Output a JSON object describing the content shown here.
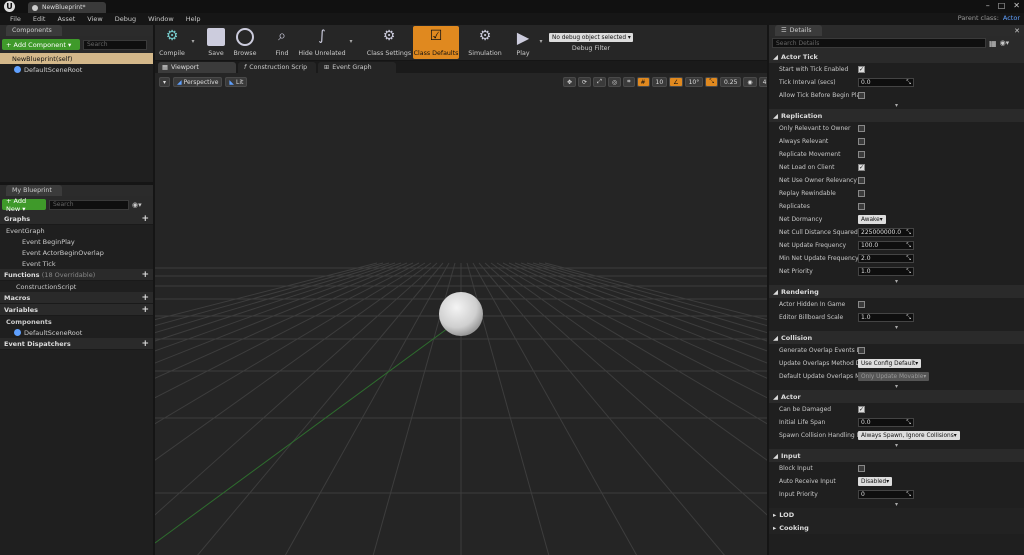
{
  "window": {
    "tab": "NewBlueprint*",
    "parent_label": "Parent class:",
    "parent_value": "Actor"
  },
  "menu": [
    "File",
    "Edit",
    "Asset",
    "View",
    "Debug",
    "Window",
    "Help"
  ],
  "components": {
    "tab": "Components",
    "add_label": "+ Add Component ▾",
    "search_placeholder": "Search",
    "items": [
      "NewBlueprint(self)",
      "DefaultSceneRoot"
    ]
  },
  "my_blueprint": {
    "tab": "My Blueprint",
    "add_label": "+ Add New ▾",
    "search_placeholder": "Search",
    "graphs_label": "Graphs",
    "graph_items": [
      "EventGraph",
      "Event BeginPlay",
      "Event ActorBeginOverlap",
      "Event Tick"
    ],
    "functions_label": "Functions",
    "functions_sub": "(18 Overridable)",
    "function_items": [
      "ConstructionScript"
    ],
    "macros_label": "Macros",
    "variables_label": "Variables",
    "components_label": "Components",
    "component_items": [
      "DefaultSceneRoot"
    ],
    "dispatchers_label": "Event Dispatchers"
  },
  "toolbar": {
    "buttons": [
      "Compile",
      "Save",
      "Browse",
      "Find",
      "Hide Unrelated",
      "Class Settings",
      "Class Defaults",
      "Simulation",
      "Play"
    ],
    "debug_select": "No debug object selected ▾",
    "debug_label": "Debug Filter"
  },
  "editor_tabs": [
    "Viewport",
    "Construction Scrip",
    "Event Graph"
  ],
  "viewport": {
    "perspective": "Perspective",
    "lit": "Lit",
    "grid_snap": "10",
    "rot_snap": "10°",
    "scale_snap": "0.25",
    "cam_speed": "4"
  },
  "details": {
    "tab": "Details",
    "search_placeholder": "Search Details",
    "sections": [
      {
        "title": "Actor Tick",
        "rows": [
          {
            "label": "Start with Tick Enabled",
            "type": "check",
            "value": true
          },
          {
            "label": "Tick Interval (secs)",
            "type": "num",
            "value": "0.0"
          },
          {
            "label": "Allow Tick Before Begin Play",
            "type": "check",
            "value": false
          }
        ]
      },
      {
        "title": "Replication",
        "rows": [
          {
            "label": "Only Relevant to Owner",
            "type": "check",
            "value": false
          },
          {
            "label": "Always Relevant",
            "type": "check",
            "value": false
          },
          {
            "label": "Replicate Movement",
            "type": "check",
            "value": false
          },
          {
            "label": "Net Load on Client",
            "type": "check",
            "value": true
          },
          {
            "label": "Net Use Owner Relevancy",
            "type": "check",
            "value": false
          },
          {
            "label": "Replay Rewindable",
            "type": "check",
            "value": false
          },
          {
            "label": "Replicates",
            "type": "check",
            "value": false
          },
          {
            "label": "Net Dormancy",
            "type": "select",
            "value": "Awake"
          },
          {
            "label": "Net Cull Distance Squared",
            "type": "num",
            "value": "225000000.0"
          },
          {
            "label": "Net Update Frequency",
            "type": "num",
            "value": "100.0"
          },
          {
            "label": "Min Net Update Frequency",
            "type": "num",
            "value": "2.0"
          },
          {
            "label": "Net Priority",
            "type": "num",
            "value": "1.0"
          }
        ]
      },
      {
        "title": "Rendering",
        "rows": [
          {
            "label": "Actor Hidden In Game",
            "type": "check",
            "value": false
          },
          {
            "label": "Editor Billboard Scale",
            "type": "num",
            "value": "1.0"
          }
        ]
      },
      {
        "title": "Collision",
        "rows": [
          {
            "label": "Generate Overlap Events Dur",
            "type": "check",
            "value": false
          },
          {
            "label": "Update Overlaps Method Dur",
            "type": "select",
            "value": "Use Config Default"
          },
          {
            "label": "Default Update Overlaps Met",
            "type": "select_dis",
            "value": "Only Update Movable"
          }
        ]
      },
      {
        "title": "Actor",
        "rows": [
          {
            "label": "Can be Damaged",
            "type": "check",
            "value": true
          },
          {
            "label": "Initial Life Span",
            "type": "num",
            "value": "0.0"
          },
          {
            "label": "Spawn Collision Handling Me",
            "type": "select",
            "value": "Always Spawn, Ignore Collisions"
          }
        ]
      },
      {
        "title": "Input",
        "rows": [
          {
            "label": "Block Input",
            "type": "check",
            "value": false
          },
          {
            "label": "Auto Receive Input",
            "type": "select",
            "value": "Disabled"
          },
          {
            "label": "Input Priority",
            "type": "num",
            "value": "0"
          }
        ]
      }
    ],
    "collapsed": [
      "LOD",
      "Cooking"
    ]
  }
}
